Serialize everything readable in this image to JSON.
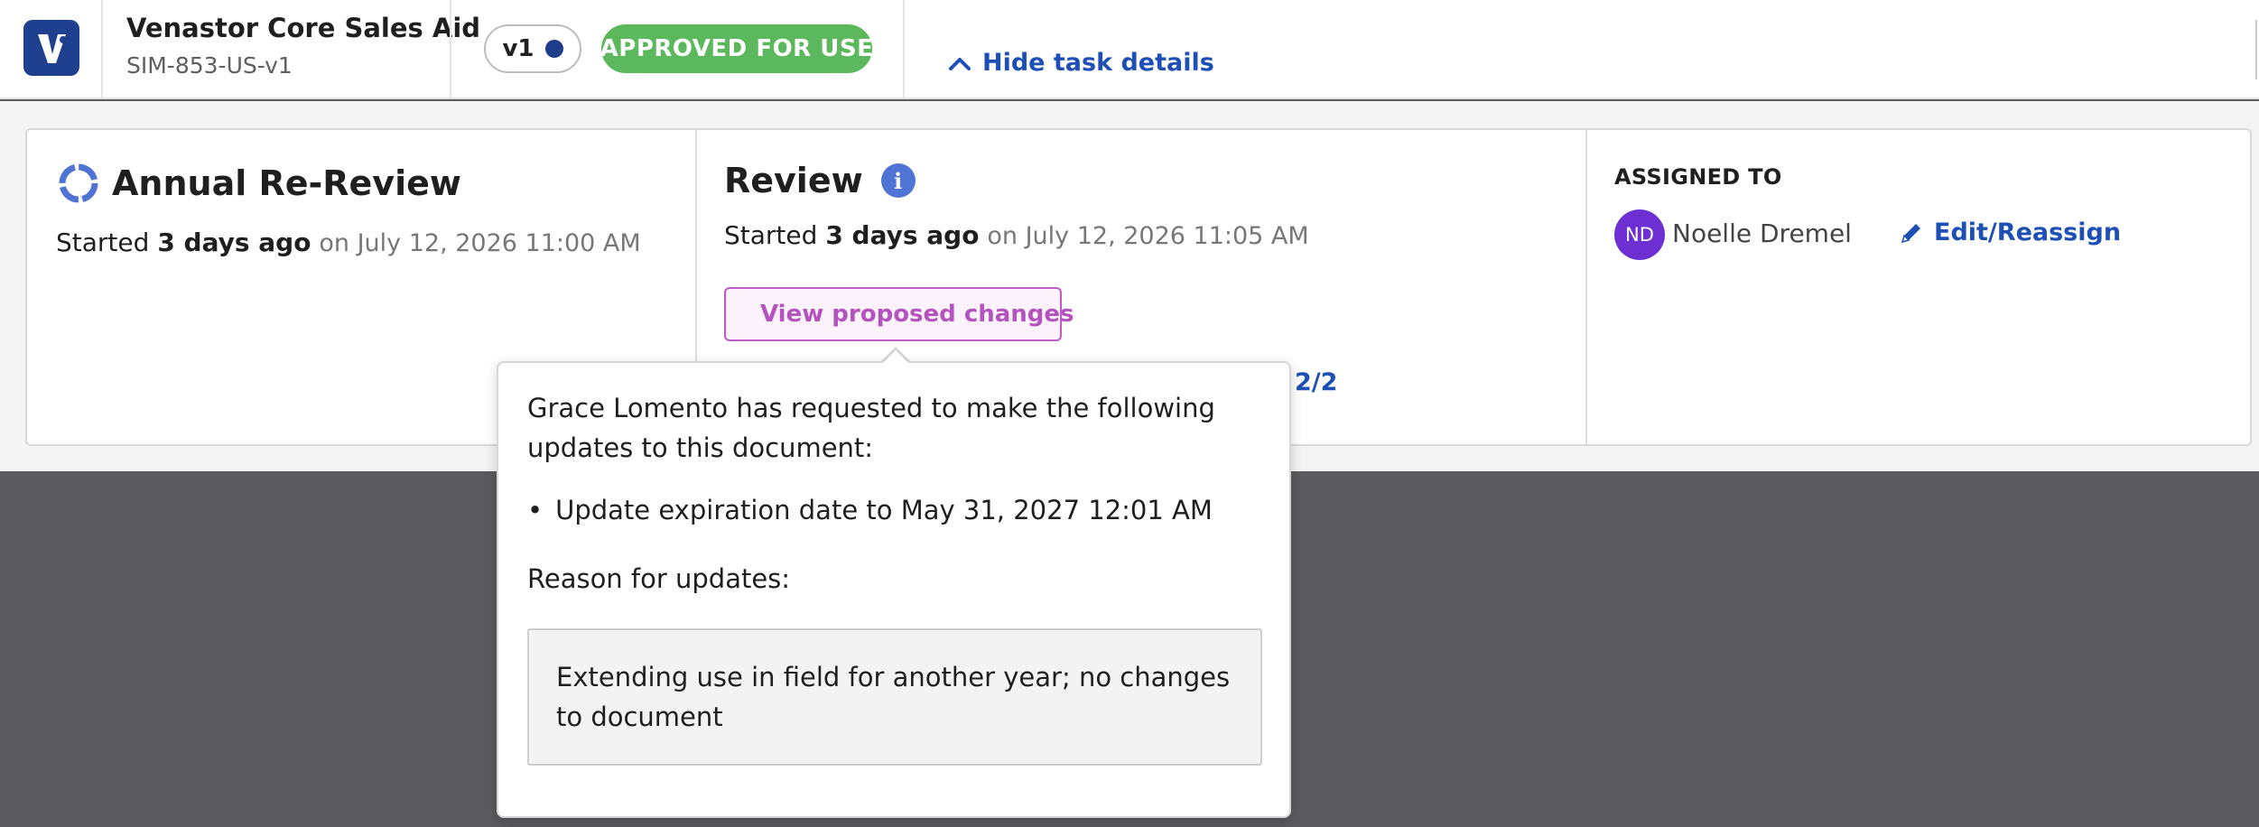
{
  "header": {
    "doc_title": "Venastor Core Sales Aid",
    "doc_id": "SIM-853-US-v1",
    "version_label": "v1",
    "status_label": "APPROVED FOR USE",
    "hide_details_label": "Hide task details"
  },
  "task": {
    "title": "Annual Re-Review",
    "started_prefix": "Started",
    "started_relative": "3 days ago",
    "started_date": "on July 12, 2026 11:00 AM"
  },
  "review": {
    "title": "Review",
    "info_glyph": "i",
    "started_prefix": "Started",
    "started_relative": "3 days ago",
    "started_date": "on July 12, 2026 11:05 AM",
    "view_changes_label": "View proposed changes",
    "pager": "2/2"
  },
  "assignment": {
    "label": "ASSIGNED TO",
    "avatar_initials": "ND",
    "assignee": "Noelle Dremel",
    "edit_label": "Edit/Reassign"
  },
  "popover": {
    "intro": "Grace Lomento has requested to make the following updates to this document:",
    "bullet": "•",
    "items": [
      "Update expiration date to May 31, 2027 12:01 AM"
    ],
    "reason_label": "Reason for updates:",
    "reason_text": "Extending use in field for another year; no changes to document"
  },
  "colors": {
    "brand": "#1f3f8f",
    "approved": "#5cb85c",
    "link": "#1d4fb5",
    "warning_accent": "#b453be",
    "avatar": "#6d2fd1",
    "overlay": "#5b5b5d"
  },
  "icons": {
    "logo": "venastor-logo-icon",
    "chevron": "chevron-up-icon",
    "task": "circular-progress-icon",
    "info": "info-icon",
    "warning": "warning-triangle-icon",
    "edit": "pencil-icon"
  }
}
